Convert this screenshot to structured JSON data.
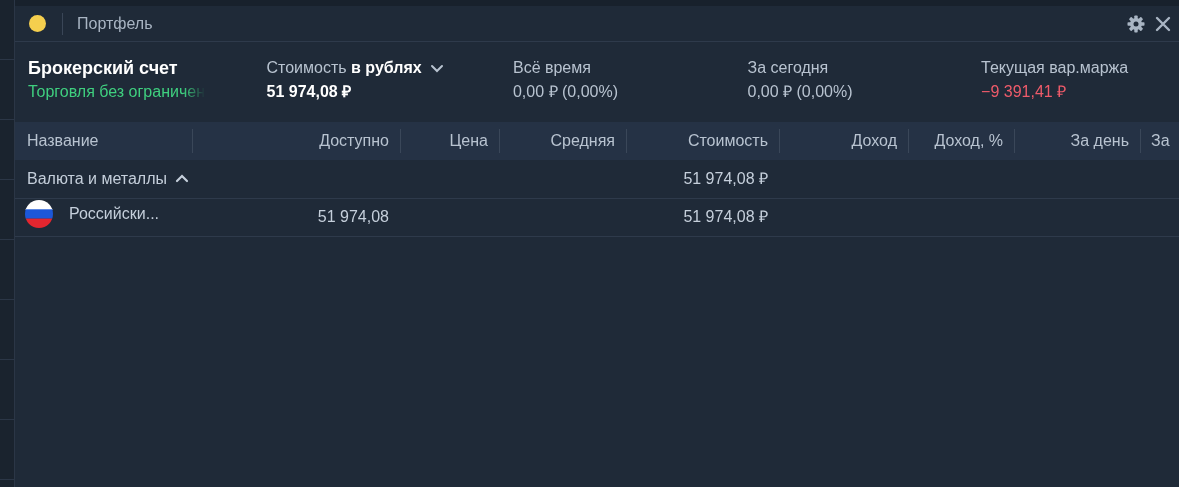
{
  "window": {
    "title": "Портфель",
    "color": "#f5cf4e"
  },
  "account": {
    "title": "Брокерский счет",
    "subtitle": "Торговля без ограничен"
  },
  "stats": [
    {
      "label": "Стоимость **в рублях**",
      "dropdown": true,
      "value": "51 974,08 ₽",
      "color": "#ffffff"
    },
    {
      "label": "Всё время",
      "dropdown": false,
      "value": "0,00 ₽ (0,00%)",
      "color": "#b8c3d0"
    },
    {
      "label": "За сегодня",
      "dropdown": false,
      "value": "0,00 ₽ (0,00%)",
      "color": "#b8c3d0"
    },
    {
      "label": "Текущая вар.маржа",
      "dropdown": false,
      "value": "−9 391,41 ₽",
      "color": "#ee5b6a"
    }
  ],
  "table": {
    "columns": [
      "Название",
      "Доступно",
      "Цена",
      "Средняя",
      "Стоимость",
      "Доход",
      "Доход, %",
      "За день",
      "За"
    ],
    "groups": [
      {
        "name": "Валюта и металлы",
        "expanded": true,
        "value": "51 974,08 ₽",
        "rows": [
          {
            "name": "Российски...",
            "available": "51 974,08",
            "value": "51 974,08 ₽"
          }
        ]
      }
    ]
  }
}
